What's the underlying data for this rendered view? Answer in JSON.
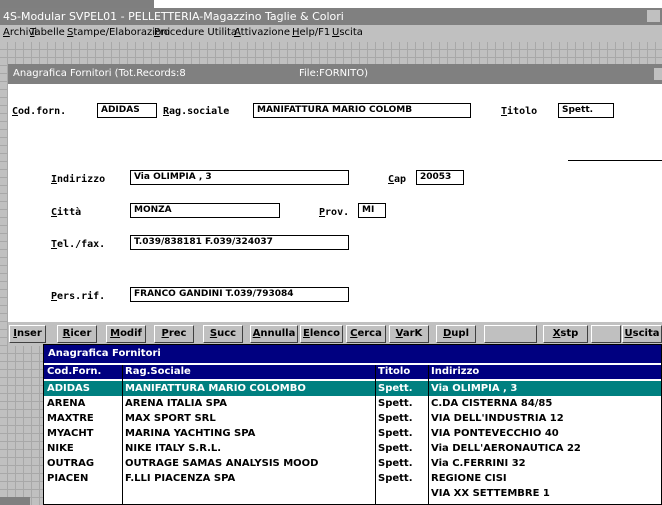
{
  "app": {
    "title": "4S-Modular SVPEL01 - PELLETTERIA-Magazzino Taglie & Colori"
  },
  "menu": [
    "Archivi",
    "Tabelle",
    "Stampe/Elaborazioni",
    "Procedure Utilita'",
    "Attivazione",
    "Help/F1",
    "Uscita"
  ],
  "form": {
    "title": "Anagrafica Fornitori (Tot.Records:8",
    "file": "File:FORNITO)",
    "labels": {
      "cod": "Cod.forn.",
      "rag": "Rag.sociale",
      "titolo": "Titolo",
      "indirizzo": "Indirizzo",
      "cap": "Cap",
      "citta": "Città",
      "prov": "Prov.",
      "tel": "Tel./fax.",
      "pers": "Pers.rif."
    },
    "values": {
      "cod": "ADIDAS",
      "rag": "MANIFATTURA MARIO COLOMB",
      "titolo": "Spett.",
      "indirizzo": "Via OLIMPIA , 3",
      "cap": "20053",
      "citta": "MONZA",
      "prov": "MI",
      "tel": "T.039/838181 F.039/324037",
      "pers": "FRANCO GANDINI T.039/793084"
    }
  },
  "buttons": [
    "Inser",
    "Ricer",
    "Modif",
    "Prec",
    "Succ",
    "Annulla",
    "Elenco",
    "Cerca",
    "VarK",
    "Dupl",
    "",
    "Xstp",
    "",
    "Uscita"
  ],
  "list": {
    "title": "Anagrafica Fornitori",
    "columns": [
      "Cod.Forn.",
      "Rag.Sociale",
      "Titolo",
      "Indirizzo"
    ],
    "rows": [
      [
        "ADIDAS",
        "MANIFATTURA MARIO COLOMBO",
        "Spett.",
        "Via OLIMPIA , 3"
      ],
      [
        "ARENA",
        "ARENA ITALIA SPA",
        "Spett.",
        "C.DA CISTERNA 84/85"
      ],
      [
        "MAXTRE",
        "MAX SPORT SRL",
        "Spett.",
        "VIA DELL'INDUSTRIA 12"
      ],
      [
        "MYACHT",
        "MARINA YACHTING SPA",
        "Spett.",
        "VIA PONTEVECCHIO 40"
      ],
      [
        "NIKE",
        "NIKE ITALY S.R.L.",
        "Spett.",
        "Via DELL'AERONAUTICA 22"
      ],
      [
        "OUTRAG",
        "OUTRAGE SAMAS ANALYSIS MOOD",
        "Spett.",
        "Via C.FERRINI 32"
      ],
      [
        "PIACEN",
        "F.LLI PIACENZA SPA",
        "Spett.",
        "REGIONE CISI"
      ],
      [
        "",
        "",
        "",
        "VIA XX SETTEMBRE 1"
      ]
    ],
    "selected_row": 0
  },
  "colors": {
    "titlebar": "#808080",
    "list_header": "#000080",
    "selection": "#008080"
  }
}
